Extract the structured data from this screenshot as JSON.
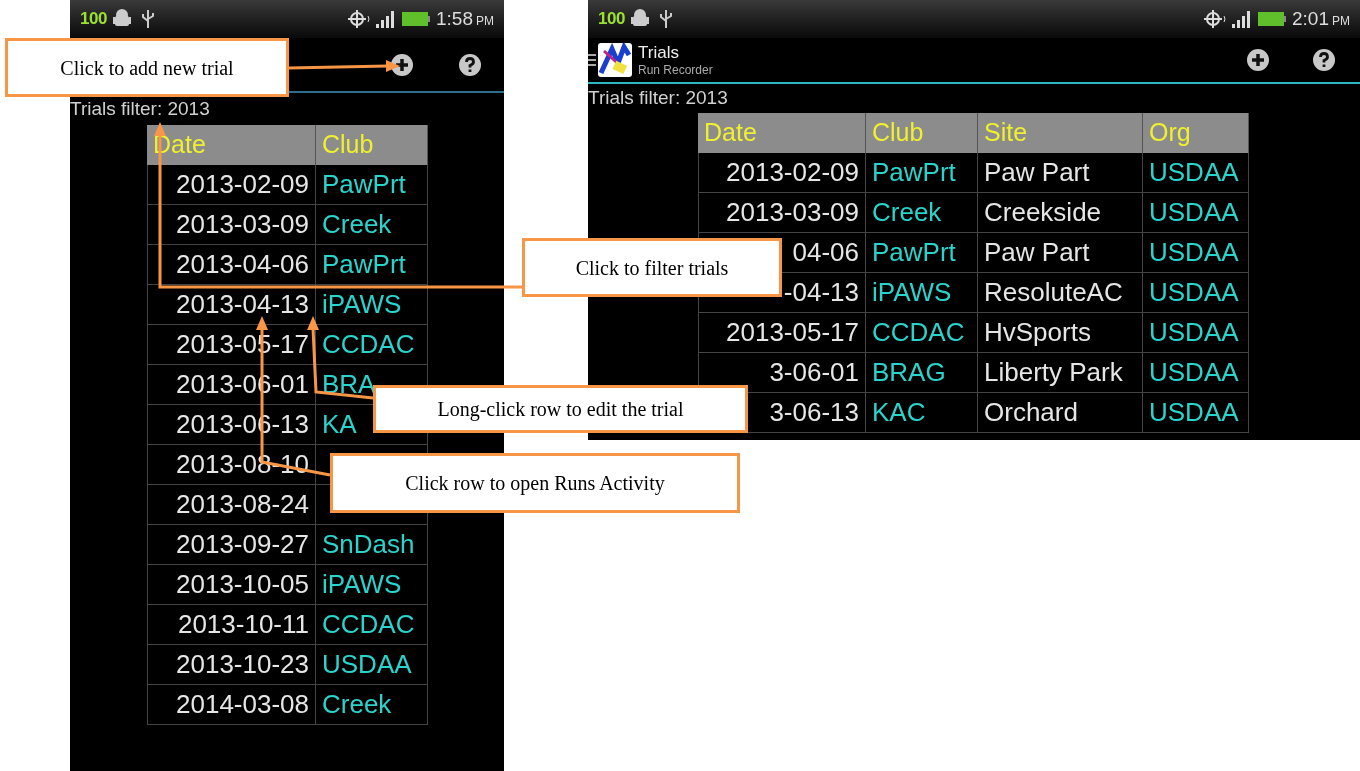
{
  "screens": [
    {
      "status_bar": {
        "battery_percent": "100",
        "time": "1:58",
        "ampm": "PM"
      },
      "filter": "Trials filter: 2013",
      "table": {
        "columns": [
          {
            "label": "Date",
            "kind": "plain"
          },
          {
            "label": "Club",
            "kind": "accent"
          }
        ],
        "rows": [
          {
            "cells": [
              "2013-02-09",
              "PawPrt"
            ]
          },
          {
            "cells": [
              "2013-03-09",
              "Creek"
            ]
          },
          {
            "cells": [
              "2013-04-06",
              "PawPrt"
            ]
          },
          {
            "cells": [
              "2013-04-13",
              "iPAWS"
            ]
          },
          {
            "cells": [
              "2013-05-17",
              "CCDAC"
            ]
          },
          {
            "cells": [
              "2013-06-01",
              "BRA"
            ]
          },
          {
            "cells": [
              "2013-06-13",
              "KA"
            ]
          },
          {
            "cells": [
              "2013-08-10"
            ]
          },
          {
            "cells": [
              "2013-08-24"
            ]
          },
          {
            "cells": [
              "2013-09-27",
              "SnDash"
            ]
          },
          {
            "cells": [
              "2013-10-05",
              "iPAWS"
            ]
          },
          {
            "cells": [
              "2013-10-11",
              "CCDAC"
            ]
          },
          {
            "cells": [
              "2013-10-23",
              "USDAA"
            ]
          },
          {
            "cells": [
              "2014-03-08",
              "Creek"
            ]
          }
        ]
      }
    },
    {
      "status_bar": {
        "battery_percent": "100",
        "time": "2:01",
        "ampm": "PM"
      },
      "action_bar": {
        "title": "Trials",
        "subtitle": "Run Recorder"
      },
      "filter": "Trials filter: 2013",
      "table": {
        "columns": [
          {
            "label": "Date",
            "kind": "plain"
          },
          {
            "label": "Club",
            "kind": "accent"
          },
          {
            "label": "Site",
            "kind": "plain"
          },
          {
            "label": "Org",
            "kind": "accent"
          }
        ],
        "rows": [
          {
            "cells": [
              "2013-02-09",
              "PawPrt",
              "Paw Part",
              "USDAA"
            ]
          },
          {
            "cells": [
              "2013-03-09",
              "Creek",
              "Creekside",
              "USDAA"
            ]
          },
          {
            "cells": [
              "04-06",
              "PawPrt",
              "Paw Part",
              "USDAA"
            ]
          },
          {
            "cells": [
              "-04-13",
              "iPAWS",
              "ResoluteAC",
              "USDAA"
            ]
          },
          {
            "cells": [
              "2013-05-17",
              "CCDAC",
              "HvSports",
              "USDAA"
            ]
          },
          {
            "cells": [
              "3-06-01",
              "BRAG",
              "Liberty Park",
              "USDAA"
            ]
          },
          {
            "cells": [
              "3-06-13",
              "KAC",
              "Orchard",
              "USDAA"
            ]
          }
        ]
      }
    }
  ],
  "callouts": [
    {
      "text": "Click to add new trial"
    },
    {
      "text": "Click to filter trials"
    },
    {
      "text": "Long-click row to edit the trial"
    },
    {
      "text": "Click row to open Runs Activity"
    }
  ]
}
